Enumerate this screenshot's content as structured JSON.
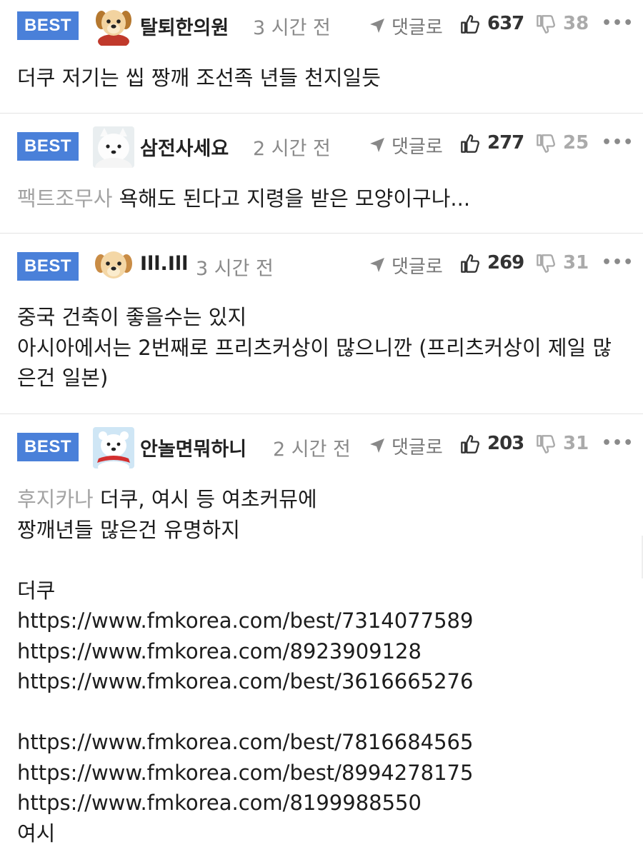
{
  "comments": [
    {
      "badge": "BEST",
      "nickname": "탈퇴한의원",
      "time": "3 시간 전",
      "reply_label": "댓글로",
      "upvotes": "637",
      "downvotes": "38",
      "more": "•••",
      "category": "",
      "text": "더쿠 저기는 씹 짱깨 조선족 년들 천지일듯",
      "avatar_icon": "puppy-avatar-icon"
    },
    {
      "badge": "BEST",
      "nickname": "삼전사세요",
      "time": "2 시간 전",
      "reply_label": "댓글로",
      "upvotes": "277",
      "downvotes": "25",
      "more": "•••",
      "category": "팩트조무사",
      "text": "욕해도 된다고 지령을 받은 모양이구나...",
      "avatar_icon": "white-dog-avatar-icon"
    },
    {
      "badge": "BEST",
      "nickname": "Ill.Ill",
      "time": "3 시간 전",
      "reply_label": "댓글로",
      "upvotes": "269",
      "downvotes": "31",
      "more": "•••",
      "category": "",
      "text": "중국 건축이 좋을수는 있지\n아시아에서는 2번째로 프리츠커상이 많으니깐 (프리츠커상이 제일 많은건 일본)",
      "avatar_icon": "puppy-avatar-icon"
    },
    {
      "badge": "BEST",
      "nickname": "안놀면뭐하니",
      "time": "2 시간 전",
      "reply_label": "댓글로",
      "upvotes": "203",
      "downvotes": "31",
      "more": "•••",
      "category": "후지카나",
      "text": "더쿠, 여시 등 여초커뮤에\n짱깨년들 많은건 유명하지\n\n더쿠\nhttps://www.fmkorea.com/best/7314077589\nhttps://www.fmkorea.com/8923909128\nhttps://www.fmkorea.com/best/3616665276\n\nhttps://www.fmkorea.com/best/7816684565\nhttps://www.fmkorea.com/best/8994278175\nhttps://www.fmkorea.com/8199988550\n여시",
      "avatar_icon": "polar-bear-avatar-icon"
    }
  ],
  "colors": {
    "best_badge": "#4a80d9",
    "time_gray": "#8a8a8a",
    "category_gray": "#a3a3a3",
    "divider": "#e3e3e3"
  }
}
